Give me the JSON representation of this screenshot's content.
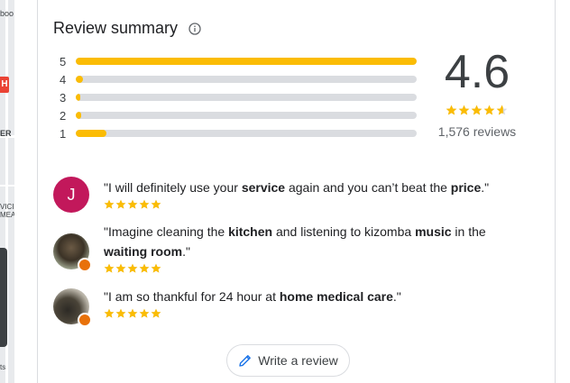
{
  "map": {
    "labels": [
      "boo",
      "ER",
      "VICI",
      "MEA",
      "ts"
    ],
    "pin_label": "H"
  },
  "summary": {
    "title": "Review summary",
    "rating": "4.6",
    "rating_value": 4.6,
    "review_count": "1,576 reviews",
    "distribution": [
      {
        "label": "5",
        "fraction": 1.0
      },
      {
        "label": "4",
        "fraction": 0.02
      },
      {
        "label": "3",
        "fraction": 0.008
      },
      {
        "label": "2",
        "fraction": 0.016
      },
      {
        "label": "1",
        "fraction": 0.09
      }
    ],
    "accent_color": "#fbbc04",
    "track_color": "#dadce0"
  },
  "reviews": [
    {
      "avatar_letter": "J",
      "avatar_color": "#c2185b",
      "segments": [
        {
          "t": "\"I will definitely use your ",
          "b": false
        },
        {
          "t": "service",
          "b": true
        },
        {
          "t": " again and you can’t beat the ",
          "b": false
        },
        {
          "t": "price",
          "b": true
        },
        {
          "t": ".\"",
          "b": false
        }
      ],
      "stars": 5
    },
    {
      "avatar_letter": "",
      "segments": [
        {
          "t": "\"Imagine cleaning the ",
          "b": false
        },
        {
          "t": "kitchen",
          "b": true
        },
        {
          "t": " and listening to kizomba ",
          "b": false
        },
        {
          "t": "music",
          "b": true
        },
        {
          "t": " in the ",
          "b": false
        },
        {
          "t": "waiting room",
          "b": true
        },
        {
          "t": ".\"",
          "b": false
        }
      ],
      "stars": 5
    },
    {
      "avatar_letter": "",
      "segments": [
        {
          "t": "\"I am so thankful for 24 hour at ",
          "b": false
        },
        {
          "t": "home medical care",
          "b": true
        },
        {
          "t": ".\"",
          "b": false
        }
      ],
      "stars": 5
    }
  ],
  "actions": {
    "write_review_label": "Write a review"
  },
  "icons": {
    "info": "info-icon",
    "pencil": "pencil-icon",
    "star": "star-icon",
    "badge": "local-guide-badge-icon"
  }
}
